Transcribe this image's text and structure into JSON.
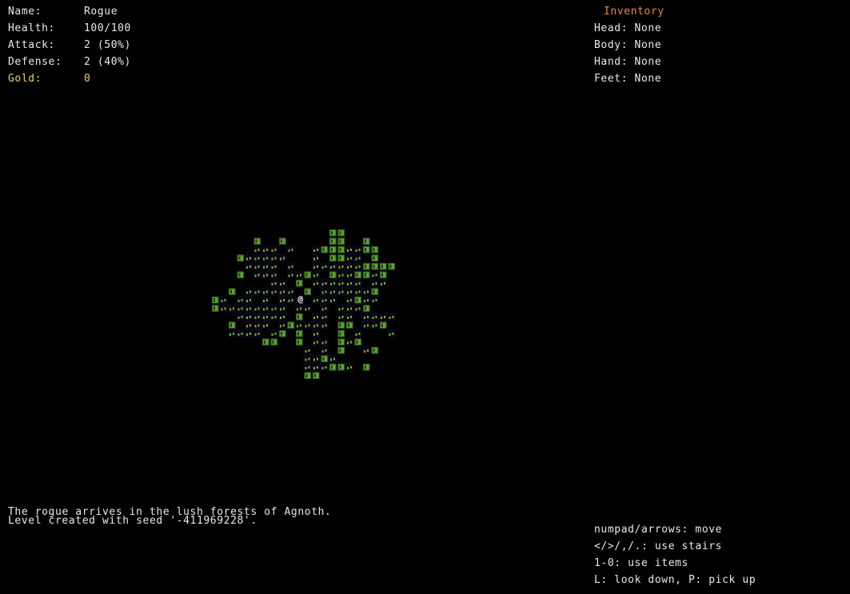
{
  "stats": {
    "name_label": "Name:",
    "name_value": "Rogue",
    "health_label": "Health:",
    "health_value": "100/100",
    "attack_label": "Attack:",
    "attack_value": "2 (50%)",
    "defense_label": "Defense:",
    "defense_value": "2 (40%)",
    "gold_label": "Gold:",
    "gold_value": "0"
  },
  "inventory": {
    "title": "Inventory",
    "head": "Head: None",
    "body": "Body: None",
    "hand": "Hand: None",
    "feet": "Feet: None"
  },
  "messages": [
    "The rogue arrives in the lush forests of Agnoth.",
    "Level created with seed '-411969228'."
  ],
  "help": [
    "numpad/arrows: move",
    "</>/,/.: use stairs",
    "1-0: use items",
    "L: look down, P: pick up"
  ],
  "map": {
    "player_glyph": "@",
    "colors": {
      "background": "#000000",
      "grass": "#6fb22e",
      "tree": "#5ea233",
      "floor": "#0b0614"
    },
    "icons": {
      "tree": "tree-icon",
      "grass": "grass-icon",
      "player": "player-icon"
    }
  }
}
